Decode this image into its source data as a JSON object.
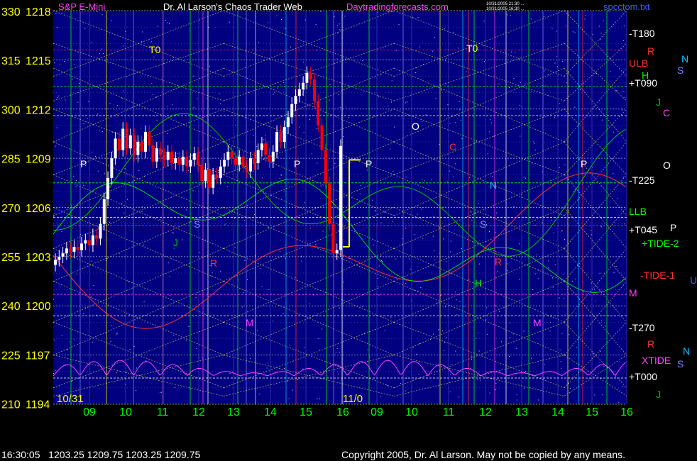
{
  "header": {
    "title_left": "S&P E-Mini",
    "title_main": "Dr. Al Larson's Chaos Trader Web",
    "site": "Daytradingforecasts.com",
    "stamp_1": "10/31/2005 21:30 ...",
    "stamp_2": "10/31/2005 16:30 ...",
    "file": "spcctom.txt"
  },
  "footer": {
    "quote": "16:30:05   1203.25 1209.75 1203.25 1209.75",
    "copyright": "Copyright 2005, Dr. Al Larson. May not be copied by any means."
  },
  "colors": {
    "background": "#000080",
    "price_up": "#ffffff",
    "price_down": "#ff0000",
    "left_labels": "#ffff00",
    "hour_labels": "#00ff00"
  },
  "chart_data": {
    "type": "candlestick",
    "left_scale_outer": [
      "330",
      "315",
      "300",
      "285",
      "270",
      "255",
      "240",
      "225",
      "210"
    ],
    "left_scale_inner": [
      "1218",
      "1215",
      "1212",
      "1209",
      "1206",
      "1203",
      "1200",
      "1197",
      "1194"
    ],
    "ylim": [
      1194,
      1218
    ],
    "x_labels": [
      "09",
      "10",
      "11",
      "12",
      "13",
      "14",
      "15",
      "16",
      "09",
      "10",
      "11",
      "12",
      "13",
      "14",
      "15",
      "16"
    ],
    "date_labels": [
      "10/31",
      "11/0"
    ],
    "right_labels": [
      {
        "text": "-T180",
        "color": "#ffffff"
      },
      {
        "text": "R",
        "color": "#ff3030"
      },
      {
        "text": "N",
        "color": "#00c0ff"
      },
      {
        "text": "ULB",
        "color": "#ff3030"
      },
      {
        "text": "H",
        "color": "#00ff00"
      },
      {
        "text": "S",
        "color": "#8080ff"
      },
      {
        "text": "+T090",
        "color": "#ffffff"
      },
      {
        "text": "J",
        "color": "#00c000"
      },
      {
        "text": "C",
        "color": "#ff40ff"
      },
      {
        "text": "O",
        "color": "#ffffff"
      },
      {
        "text": "-T225",
        "color": "#ffffff"
      },
      {
        "text": "LLB",
        "color": "#00ff00"
      },
      {
        "text": "+T045",
        "color": "#ffffff"
      },
      {
        "text": "P",
        "color": "#ffffff"
      },
      {
        "text": "+TIDE-2",
        "color": "#00ff00"
      },
      {
        "text": "-TIDE-1",
        "color": "#ff3030"
      },
      {
        "text": "U",
        "color": "#4060ff"
      },
      {
        "text": "M",
        "color": "#ff40ff"
      },
      {
        "text": "-T270",
        "color": "#ffffff"
      },
      {
        "text": "R",
        "color": "#ff3030"
      },
      {
        "text": "N",
        "color": "#00c0ff"
      },
      {
        "text": "XTIDE",
        "color": "#ff40ff"
      },
      {
        "text": "S",
        "color": "#8080ff"
      },
      {
        "text": "+T000",
        "color": "#ffffff"
      },
      {
        "text": "J",
        "color": "#00c000"
      }
    ],
    "plot_labels": [
      {
        "text": "T0",
        "color": "#ffff00"
      },
      {
        "text": "T0",
        "color": "#ffff00"
      },
      {
        "text": "P",
        "color": "#ffffff"
      },
      {
        "text": "P",
        "color": "#ffffff"
      },
      {
        "text": "P",
        "color": "#ffffff"
      },
      {
        "text": "P",
        "color": "#ffffff"
      },
      {
        "text": "O",
        "color": "#ffffff"
      },
      {
        "text": "C",
        "color": "#ff3030"
      },
      {
        "text": "N",
        "color": "#00c0ff"
      },
      {
        "text": "S",
        "color": "#8080ff"
      },
      {
        "text": "S",
        "color": "#8080ff"
      },
      {
        "text": "R",
        "color": "#ff3030"
      },
      {
        "text": "R",
        "color": "#ff3030"
      },
      {
        "text": "H",
        "color": "#00ff00"
      },
      {
        "text": "M",
        "color": "#ff40ff"
      },
      {
        "text": "M",
        "color": "#ff40ff"
      },
      {
        "text": "J",
        "color": "#00c000"
      }
    ],
    "candles_close": [
      1202.8,
      1203.0,
      1203.2,
      1203.5,
      1203.3,
      1203.6,
      1203.4,
      1203.8,
      1204.0,
      1203.7,
      1204.3,
      1204.1,
      1205.0,
      1206.5,
      1207.8,
      1209.0,
      1210.2,
      1209.5,
      1210.8,
      1209.6,
      1210.4,
      1209.2,
      1210.0,
      1209.4,
      1210.6,
      1209.8,
      1208.8,
      1209.6,
      1209.2,
      1208.9,
      1209.4,
      1208.7,
      1209.0,
      1208.6,
      1209.1,
      1208.5,
      1208.9,
      1209.3,
      1208.6,
      1207.6,
      1208.3,
      1207.2,
      1208.0,
      1207.8,
      1208.5,
      1208.9,
      1209.4,
      1209.0,
      1208.6,
      1209.1,
      1208.5,
      1208.2,
      1209.0,
      1208.7,
      1209.5,
      1209.9,
      1209.2,
      1208.8,
      1209.4,
      1210.6,
      1210.0,
      1210.9,
      1211.5,
      1212.3,
      1212.8,
      1213.2,
      1213.6,
      1214.2,
      1213.8,
      1212.5,
      1211.0,
      1209.5,
      1207.5,
      1205.0,
      1203.2,
      1203.4,
      1209.75
    ]
  }
}
